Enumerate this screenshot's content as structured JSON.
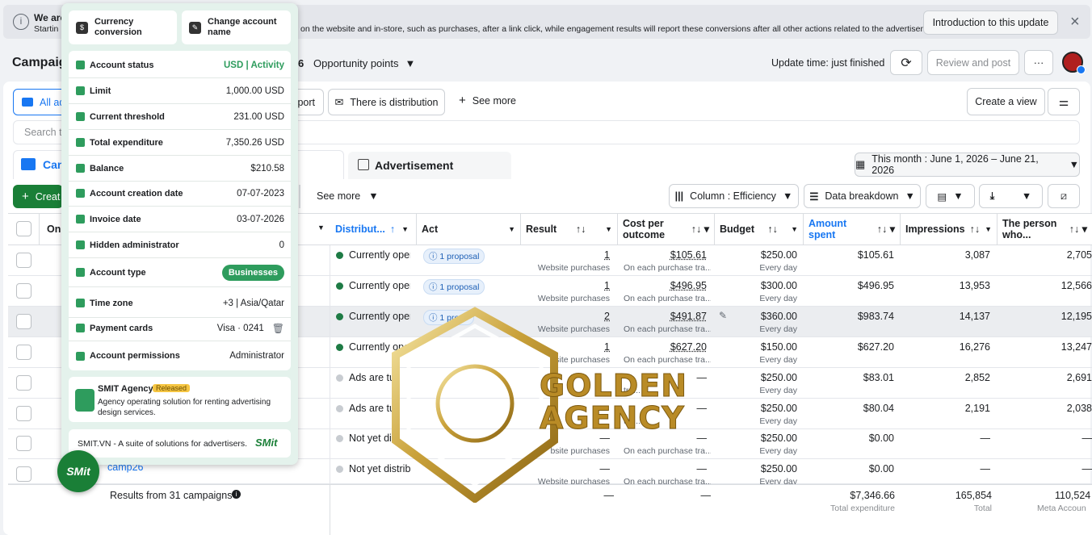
{
  "banner": {
    "text_a": "We are",
    "text_b": "Startin",
    "text_main": "on the website and in-store, such as purchases, after a link click, while engagement results will report these conversions after all other actions related to the advertisement.",
    "intro_button": "Introduction to this update",
    "close": "×"
  },
  "header": {
    "title": "Campaig",
    "partial_number": "6",
    "opportunity": "Opportunity points",
    "update_time": "Update time: just finished",
    "review_button": "Review and post",
    "more_button": "···"
  },
  "filters": {
    "all_ads": "All ad",
    "report_partial": "port",
    "distribution": "There is distribution",
    "see_more": "See more",
    "create_view": "Create a view",
    "search_placeholder": "Search to"
  },
  "tabs": {
    "campaign": "Can",
    "advertisement": "Advertisement",
    "date_range": "This month : June 1, 2026 – June 21, 2026"
  },
  "toolbar": {
    "create": "Creat",
    "see_more": "See more",
    "column": "Column : Efficiency",
    "breakdown": "Data breakdown"
  },
  "columns": {
    "on": "On.",
    "distribution": "Distribut...",
    "act": "Act",
    "result": "Result",
    "cost_a": "Cost per",
    "cost_b": "outcome",
    "budget": "Budget",
    "amount_a": "Amount",
    "amount_b": "spent",
    "impressions": "Impressions",
    "person_a": "The person",
    "person_b": "who..."
  },
  "rows": [
    {
      "status": "Currently opera",
      "status_color": "#1e7b45",
      "act": "1 proposal",
      "result": "1",
      "result_sub": "Website purchases",
      "cost": "$105.61",
      "cost_sub": "On each purchase tra...",
      "budget": "$250.00",
      "budget_sub": "Every day",
      "spent": "$105.61",
      "impressions": "3,087",
      "reach": "2,705"
    },
    {
      "status": "Currently opera",
      "status_color": "#1e7b45",
      "act": "1 proposal",
      "result": "1",
      "result_sub": "Website purchases",
      "cost": "$496.95",
      "cost_sub": "On each purchase tra...",
      "budget": "$300.00",
      "budget_sub": "Every day",
      "spent": "$496.95",
      "impressions": "13,953",
      "reach": "12,566"
    },
    {
      "status": "Currently opera",
      "status_color": "#1e7b45",
      "act": "1 propo",
      "result": "2",
      "result_sub": "Website purchases",
      "cost": "$491.87",
      "cost_sub": "On each purchase tra...",
      "budget": "$360.00",
      "budget_sub": "Every day",
      "spent": "$983.74",
      "impressions": "14,137",
      "reach": "12,195"
    },
    {
      "status": "Currently oper",
      "status_color": "#1e7b45",
      "act": "",
      "result": "1",
      "result_sub": "site purchases",
      "cost": "$627.20",
      "cost_sub": "On each purchase tra...",
      "budget": "$150.00",
      "budget_sub": "Every day",
      "spent": "$627.20",
      "impressions": "16,276",
      "reach": "13,247"
    },
    {
      "status": "Ads are tu",
      "status_color": "#c8ccd1",
      "act": "",
      "result": "",
      "result_sub": "",
      "cost": "—",
      "cost_sub": "tra...",
      "budget": "$250.00",
      "budget_sub": "Every day",
      "spent": "$83.01",
      "impressions": "2,852",
      "reach": "2,691"
    },
    {
      "status": "Ads are tu",
      "status_color": "#c8ccd1",
      "act": "",
      "result": "",
      "result_sub": "",
      "cost": "—",
      "cost_sub": "tra...",
      "budget": "$250.00",
      "budget_sub": "Every day",
      "spent": "$80.04",
      "impressions": "2,191",
      "reach": "2,038"
    },
    {
      "status": "Not yet dis",
      "status_color": "#c8ccd1",
      "act": "",
      "result": "—",
      "result_sub": "bsite purchases",
      "cost": "—",
      "cost_sub": "On each purchase tra...",
      "budget": "$250.00",
      "budget_sub": "Every day",
      "spent": "$0.00",
      "impressions": "—",
      "reach": "—"
    },
    {
      "status": "Not yet distrib",
      "status_color": "#c8ccd1",
      "act": "",
      "result": "—",
      "result_sub": "Website purchases",
      "cost": "—",
      "cost_sub": "On each purchase tra...",
      "budget": "$250.00",
      "budget_sub": "Every day",
      "spent": "$0.00",
      "impressions": "—",
      "reach": "—"
    }
  ],
  "last_campaign": "camp26",
  "totals": {
    "label": "Results from 31 campaigns",
    "result": "—",
    "cost": "—",
    "budget": "—",
    "spent": "$7,346.66",
    "spent_sub": "Total expenditure",
    "impressions": "165,854",
    "impressions_sub": "Total",
    "reach": "110,524",
    "reach_sub": "Meta Accoun"
  },
  "panel": {
    "currency": "Currency conversion",
    "change_name": "Change account name",
    "items": [
      {
        "label": "Account status",
        "value": "USD | Activity"
      },
      {
        "label": "Limit",
        "value": "1,000.00 USD"
      },
      {
        "label": "Current threshold",
        "value": "231.00 USD"
      },
      {
        "label": "Total expenditure",
        "value": "7,350.26 USD"
      },
      {
        "label": "Balance",
        "value": "$210.58"
      },
      {
        "label": "Account creation date",
        "value": "07-07-2023"
      },
      {
        "label": "Invoice date",
        "value": "03-07-2026"
      },
      {
        "label": "Hidden administrator",
        "value": "0"
      },
      {
        "label": "Account type",
        "value": "Businesses"
      },
      {
        "label": "Time zone",
        "value": "+3 | Asia/Qatar"
      },
      {
        "label": "Payment cards",
        "value": "Visa · 0241"
      },
      {
        "label": "Account permissions",
        "value": "Administrator"
      }
    ],
    "agency_title": "SMIT Agency",
    "agency_badge": "Released",
    "agency_desc": "Agency operating solution for renting advertising design services.",
    "footer_text": "SMIT.VN - A suite of solutions for advertisers.",
    "footer_logo": "SMit",
    "fab": "SMit"
  },
  "watermark": {
    "line1": "GOLDEN",
    "line2": "AGENCY"
  }
}
